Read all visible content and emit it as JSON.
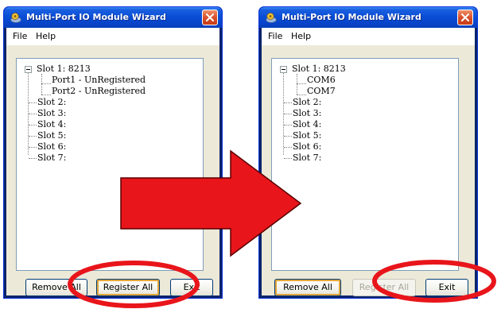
{
  "left_window": {
    "title": "Multi-Port IO Module Wizard",
    "menu": [
      "File",
      "Help"
    ],
    "tree": {
      "slot1": "Slot 1: 8213",
      "children": [
        "Port1 - UnRegistered",
        "Port2 - UnRegistered"
      ],
      "slots": [
        "Slot 2:",
        "Slot 3:",
        "Slot 4:",
        "Slot 5:",
        "Slot 6:",
        "Slot 7:"
      ]
    },
    "buttons": {
      "remove_all": "Remove All",
      "register_all": "Register All",
      "exit": "Exit"
    }
  },
  "right_window": {
    "title": "Multi-Port IO Module Wizard",
    "menu": [
      "File",
      "Help"
    ],
    "tree": {
      "slot1": "Slot 1: 8213",
      "children": [
        "COM6",
        "COM7"
      ],
      "slots": [
        "Slot 2:",
        "Slot 3:",
        "Slot 4:",
        "Slot 5:",
        "Slot 6:",
        "Slot 7:"
      ]
    },
    "buttons": {
      "remove_all": "Remove All",
      "register_all": "Register All",
      "exit": "Exit"
    }
  },
  "colors": {
    "title_bar": "#0a4ed6",
    "arrow_fill": "#e8151b",
    "highlight_ellipse": "#e8151b"
  },
  "icons": [
    "app-icon",
    "close-icon",
    "collapse-icon",
    "arrow-right-icon"
  ]
}
